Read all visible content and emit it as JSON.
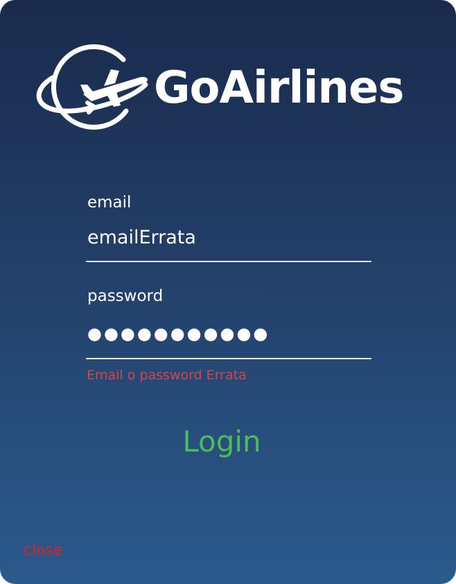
{
  "app": {
    "brand_name": "GoAirlines"
  },
  "form": {
    "email_label": "email",
    "email_value": "emailErrata",
    "password_label": "password",
    "password_masked": "●●●●●●●●●●●",
    "error_message": "Email o password Errata",
    "login_label": "Login",
    "close_label": "close"
  },
  "colors": {
    "background_top": "#1a2a4c",
    "background_bottom": "#2b5a8d",
    "error": "#d64545",
    "login": "#4cbb5a",
    "close": "#e21f1f"
  },
  "icons": {
    "logo": "plane-orbit-icon"
  }
}
